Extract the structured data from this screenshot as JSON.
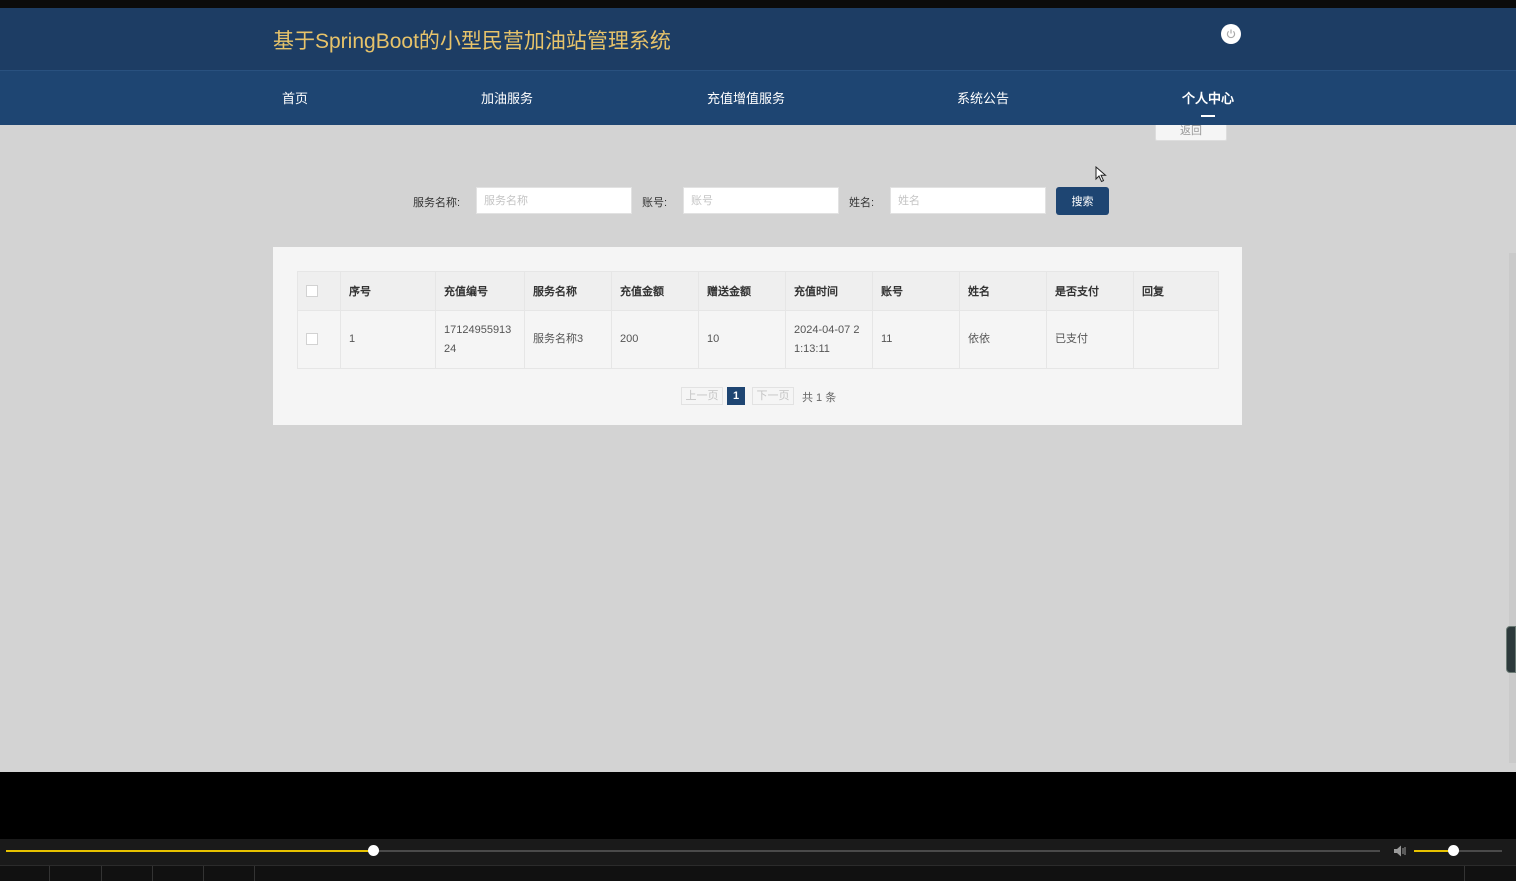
{
  "header": {
    "title": "基于SpringBoot的小型民营加油站管理系统",
    "power_icon": "power-icon"
  },
  "nav": {
    "items": [
      {
        "label": "首页"
      },
      {
        "label": "加油服务"
      },
      {
        "label": "充值增值服务"
      },
      {
        "label": "系统公告"
      },
      {
        "label": "个人中心",
        "active": true
      }
    ]
  },
  "toolbar": {
    "back_label": "返回"
  },
  "search": {
    "service_label": "服务名称:",
    "service_placeholder": "服务名称",
    "account_label": "账号:",
    "account_placeholder": "账号",
    "name_label": "姓名:",
    "name_placeholder": "姓名",
    "button": "搜索"
  },
  "table": {
    "headers": [
      "序号",
      "充值编号",
      "服务名称",
      "充值金额",
      "赠送金额",
      "充值时间",
      "账号",
      "姓名",
      "是否支付",
      "回复"
    ],
    "rows": [
      [
        "1",
        "1712495591324",
        "服务名称3",
        "200",
        "10",
        "2024-04-07 21:13:11",
        "11",
        "依依",
        "已支付",
        ""
      ]
    ]
  },
  "pagination": {
    "prev": "上一页",
    "current": "1",
    "next": "下一页",
    "total": "共 1 条"
  },
  "player": {
    "progress": 0.267,
    "volume": 0.44
  },
  "colors": {
    "header_bg": "#1d3d64",
    "nav_bg": "#1e4572",
    "title": "#e7c36a",
    "accent": "#1e4572",
    "player_accent": "#e7c200"
  }
}
